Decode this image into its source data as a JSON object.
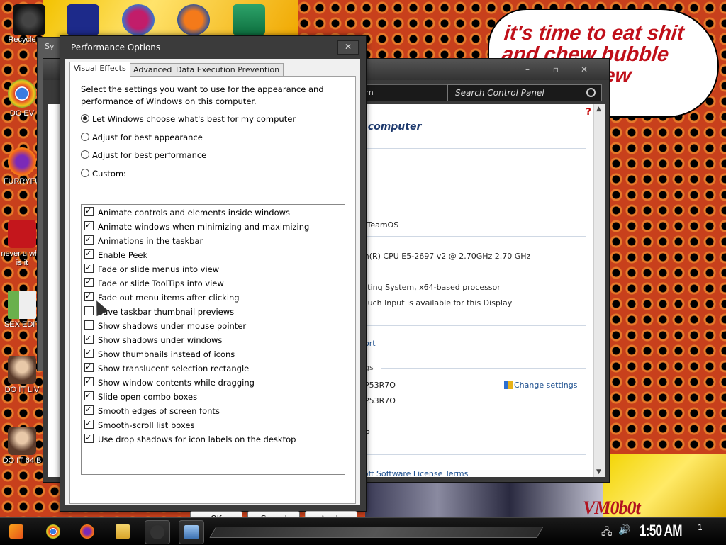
{
  "desktop": {
    "speech_bubble": "it's time to eat shit and chew bubble gum and dew",
    "watermark": "VM0b0t",
    "icons": [
      {
        "label": "Recycle",
        "icon": "recycle-bin-icon"
      },
      {
        "label": "DO EV",
        "icon": "chrome-icon"
      },
      {
        "label": "FURRYFU",
        "icon": "firefox-icon"
      },
      {
        "label": "never u why is it",
        "icon": "devcpp-icon"
      },
      {
        "label": "SEX EDIT",
        "icon": "hex-editor-icon"
      },
      {
        "label": "DO IT LIV",
        "icon": "portrait-icon"
      },
      {
        "label": "DO IT 64 B",
        "icon": "portrait-icon"
      }
    ],
    "top_icons": [
      "stick-icon",
      "de-icon",
      "question-icon",
      "p-icon",
      "publisher-icon"
    ]
  },
  "system_window": {
    "title_partial": "Sy",
    "tab_partial": "Co"
  },
  "control_panel": {
    "search_placeholder": "Search Control Panel",
    "address_partial": "m",
    "heading_partial": "r computer",
    "edition_partial": "h TeamOS",
    "processor_partial": "on(R) CPU E5-2697 v2 @ 2.70GHz   2.70 GHz",
    "system_type_partial": "rating System, x64-based processor",
    "pen_touch_partial": "Touch Input is available for this Display",
    "support_link_partial": "port",
    "settings_section_partial": "ngs",
    "computer_name_partial": "0P53R7O",
    "full_name_partial": "0P53R7O",
    "workgroup_partial": "UP",
    "change_settings_label": "Change settings",
    "license_partial": "soft Software License Terms"
  },
  "dialog": {
    "title": "Performance Options",
    "tabs": [
      {
        "label": "Visual Effects",
        "active": true
      },
      {
        "label": "Advanced",
        "active": false
      },
      {
        "label": "Data Execution Prevention",
        "active": false
      }
    ],
    "description": "Select the settings you want to use for the appearance and performance of Windows on this computer.",
    "radios": [
      {
        "label": "Let Windows choose what's best for my computer",
        "checked": true
      },
      {
        "label": "Adjust for best appearance",
        "checked": false
      },
      {
        "label": "Adjust for best performance",
        "checked": false
      },
      {
        "label": "Custom:",
        "checked": false
      }
    ],
    "effects": [
      {
        "label": "Animate controls and elements inside windows",
        "checked": true
      },
      {
        "label": "Animate windows when minimizing and maximizing",
        "checked": true
      },
      {
        "label": "Animations in the taskbar",
        "checked": true
      },
      {
        "label": "Enable Peek",
        "checked": true
      },
      {
        "label": "Fade or slide menus into view",
        "checked": true
      },
      {
        "label": "Fade or slide ToolTips into view",
        "checked": true
      },
      {
        "label": "Fade out menu items after clicking",
        "checked": true
      },
      {
        "label": "Save taskbar thumbnail previews",
        "checked": false
      },
      {
        "label": "Show shadows under mouse pointer",
        "checked": false
      },
      {
        "label": "Show shadows under windows",
        "checked": true
      },
      {
        "label": "Show thumbnails instead of icons",
        "checked": true
      },
      {
        "label": "Show translucent selection rectangle",
        "checked": true
      },
      {
        "label": "Show window contents while dragging",
        "checked": true
      },
      {
        "label": "Slide open combo boxes",
        "checked": true
      },
      {
        "label": "Smooth edges of screen fonts",
        "checked": true
      },
      {
        "label": "Smooth-scroll list boxes",
        "checked": true
      },
      {
        "label": "Use drop shadows for icon labels on the desktop",
        "checked": true
      }
    ],
    "buttons": {
      "ok": "OK",
      "cancel": "Cancel",
      "apply": "Apply"
    }
  },
  "taskbar": {
    "clock": "1:50 AM",
    "notification_count": "1",
    "pinned": [
      "start-icon",
      "chrome-icon",
      "firefox-icon",
      "explorer-icon",
      "music-icon",
      "control-panel-icon"
    ]
  }
}
